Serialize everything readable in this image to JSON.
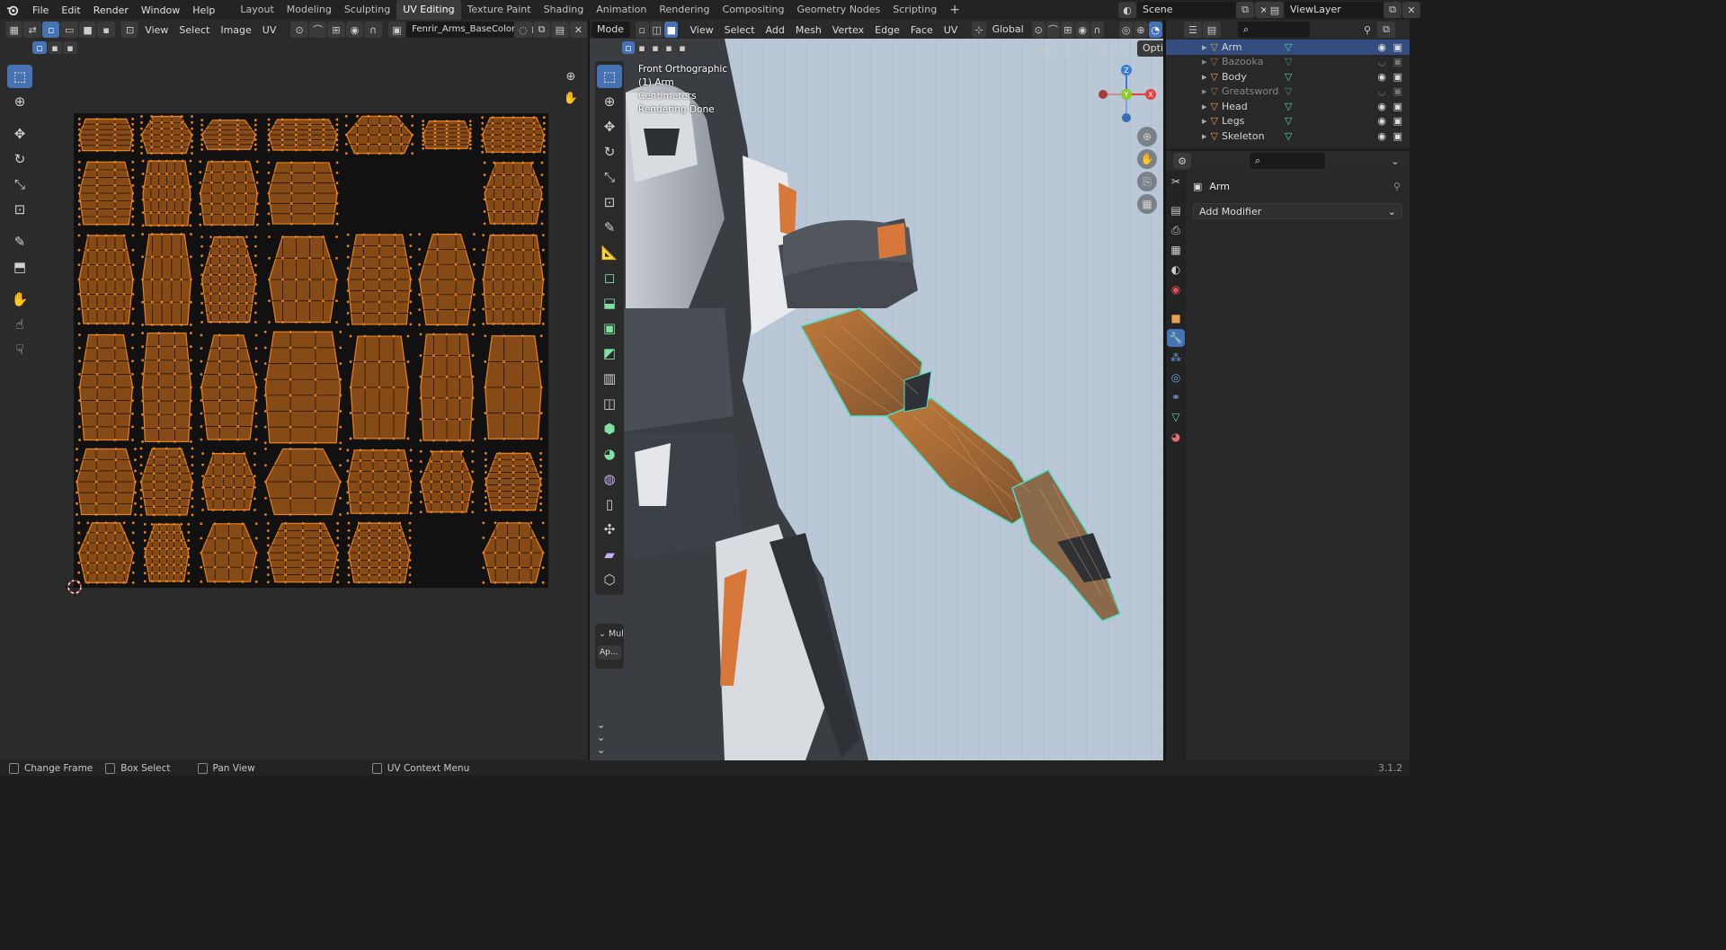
{
  "app": {
    "menu": [
      "File",
      "Edit",
      "Render",
      "Window",
      "Help"
    ],
    "workspaces": [
      "Layout",
      "Modeling",
      "Sculpting",
      "UV Editing",
      "Texture Paint",
      "Shading",
      "Animation",
      "Rendering",
      "Compositing",
      "Geometry Nodes",
      "Scripting"
    ],
    "active_workspace": "UV Editing",
    "add_workspace": "+",
    "scene": "Scene",
    "view_layer": "ViewLayer",
    "version": "3.1.2"
  },
  "uv_editor": {
    "menus": [
      "View",
      "Select",
      "Image",
      "UV"
    ],
    "image_name": "Fenrir_Arms_BaseColor.png"
  },
  "viewport": {
    "mode": "Mode",
    "menus": [
      "View",
      "Select",
      "Add",
      "Mesh",
      "Vertex",
      "Edge",
      "Face",
      "UV"
    ],
    "transform_orientation": "Global",
    "axes": [
      "X",
      "Y",
      "Z"
    ],
    "options_label": "Options",
    "info": [
      "Front Orthographic",
      "(1) Arm",
      "Centimeters",
      "Rendering Done"
    ],
    "operator_panel_label": "Mul",
    "operator_apply": "Ap...",
    "gizmo_axes": {
      "z": "Z",
      "y": "Y",
      "x": "X"
    }
  },
  "outliner": {
    "items": [
      {
        "name": "Arm",
        "selected": true,
        "visible": true
      },
      {
        "name": "Bazooka",
        "selected": false,
        "visible": false
      },
      {
        "name": "Body",
        "selected": false,
        "visible": true
      },
      {
        "name": "Greatsword",
        "selected": false,
        "visible": false
      },
      {
        "name": "Head",
        "selected": false,
        "visible": true
      },
      {
        "name": "Legs",
        "selected": false,
        "visible": true
      },
      {
        "name": "Skeleton",
        "selected": false,
        "visible": true
      }
    ]
  },
  "properties": {
    "object_name": "Arm",
    "add_modifier": "Add Modifier"
  },
  "statusbar": {
    "items": [
      "Change Frame",
      "Box Select",
      "Pan View",
      "UV Context Menu"
    ]
  },
  "colors": {
    "accent": "#4772b3",
    "uv_orange": "#e8821e",
    "selection_teal": "#4fe0c8",
    "viewport_bg": "#b9c7d6"
  }
}
